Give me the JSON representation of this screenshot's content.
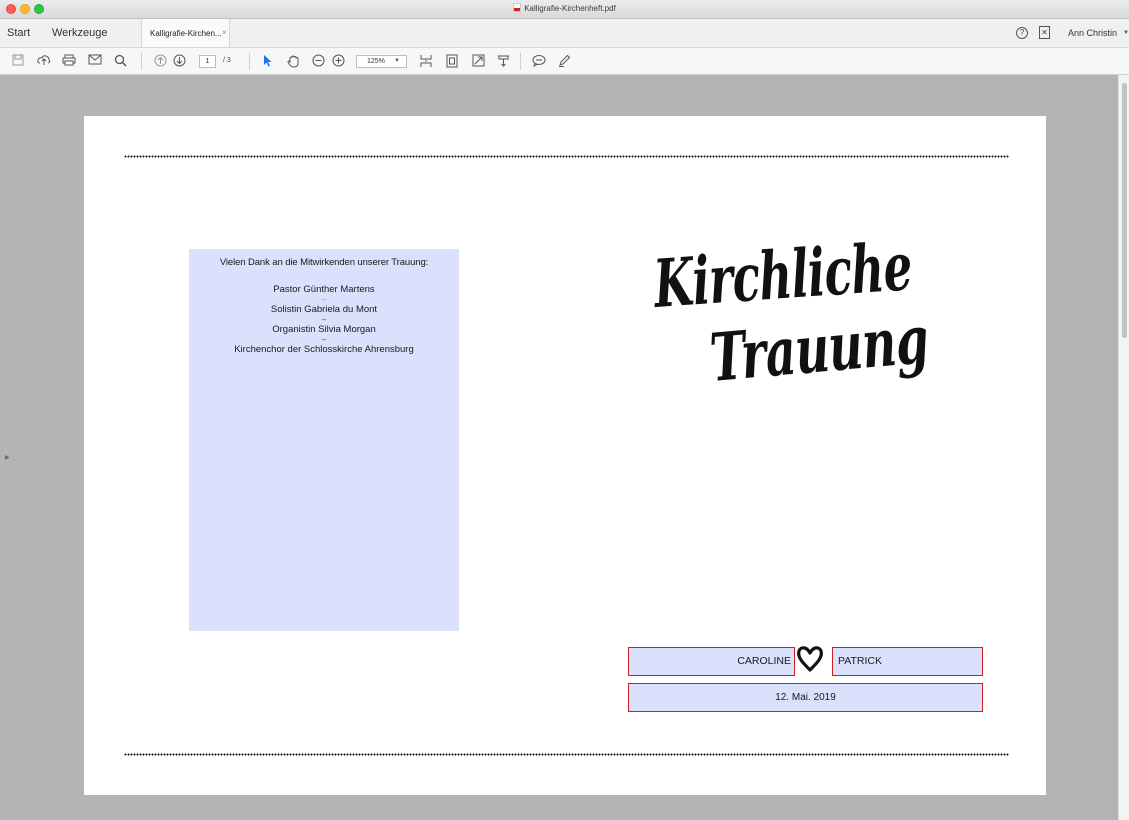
{
  "window": {
    "title": "Kalligrafie-Kirchenheft.pdf"
  },
  "tabbar": {
    "start_label": "Start",
    "tools_label": "Werkzeuge",
    "document_tab_label": "Kalligrafie-Kirchen...",
    "tab_close": "×",
    "user_name": "Ann Christin"
  },
  "toolbar": {
    "current_page": "1",
    "total_pages": "/ 3",
    "zoom": "125%"
  },
  "document": {
    "thanks_title": "Vielen Dank an die Mitwirkenden unserer Trauung:",
    "credits": [
      "Pastor Günther Martens",
      "Solistin Gabriela du Mont",
      "Organistin Silvia Morgan",
      "Kirchenchor der Schlosskirche Ahrensburg"
    ],
    "credit_separator": "–",
    "title_line_1": "Kirchliche",
    "title_line_2": "Trauung",
    "name_left": "CAROLINE",
    "name_right": "PATRICK",
    "date": "12. Mai. 2019"
  },
  "colors": {
    "form_field_fill": "#dbe0fc",
    "form_field_border": "#d21e1e",
    "viewer_background": "#b4b4b4",
    "select_tool_accent": "#1a73e8"
  }
}
